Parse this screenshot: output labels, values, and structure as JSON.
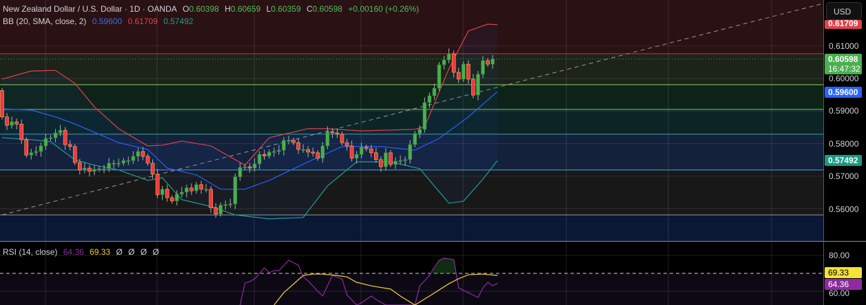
{
  "header": {
    "symbol": "New Zealand Dollar / U.S. Dollar · 1D · OANDA",
    "o_label": "O",
    "o": "0.60398",
    "h_label": "H",
    "h": "0.60659",
    "l_label": "L",
    "l": "0.60359",
    "c_label": "C",
    "c": "0.60598",
    "change": "+0.00160 (+0.26%)"
  },
  "bb_legend": {
    "label": "BB (20, SMA, close, 2)",
    "basis": "0.59600",
    "upper": "0.61709",
    "lower": "0.57492"
  },
  "rsi_legend": {
    "label": "RSI (14, close)",
    "rsi": "64.36",
    "ma": "69.33",
    "empties": [
      "Ø",
      "Ø",
      "Ø",
      "Ø"
    ]
  },
  "axis": {
    "currency": "USD",
    "price_ticks": [
      "0.61000",
      "0.60000",
      "0.59000",
      "0.58000",
      "0.57000",
      "0.56000"
    ],
    "rsi_ticks": [
      "80.00",
      "60.00"
    ],
    "tags": {
      "upper": "0.61709",
      "last": "0.60598",
      "countdown": "16:47:32",
      "basis": "0.59600",
      "lower": "0.57492",
      "rsi_ma": "69.33",
      "rsi": "64.36"
    }
  },
  "colors": {
    "up": "#4caf50",
    "down": "#f23645",
    "basis": "#2962ff",
    "upper": "#e0424a",
    "lower": "#22a08a",
    "rsi": "#8e2aa2",
    "rsi_ma": "#f2d13c"
  },
  "chart_data": {
    "type": "candlestick",
    "title": "New Zealand Dollar / U.S. Dollar · 1D · OANDA",
    "first_open": 0.5963,
    "closes": [
      0.5882,
      0.5856,
      0.5867,
      0.586,
      0.5812,
      0.5765,
      0.5772,
      0.5776,
      0.5793,
      0.5816,
      0.5818,
      0.5833,
      0.5841,
      0.5797,
      0.5791,
      0.5742,
      0.5719,
      0.5725,
      0.5715,
      0.5721,
      0.5723,
      0.5723,
      0.574,
      0.574,
      0.574,
      0.5748,
      0.5748,
      0.5761,
      0.5776,
      0.5761,
      0.574,
      0.5706,
      0.5643,
      0.566,
      0.5634,
      0.5624,
      0.5645,
      0.5651,
      0.5664,
      0.5655,
      0.5674,
      0.566,
      0.566,
      0.5603,
      0.5584,
      0.5611,
      0.5613,
      0.5615,
      0.5698,
      0.5727,
      0.5729,
      0.5725,
      0.5738,
      0.5767,
      0.5762,
      0.5774,
      0.5776,
      0.578,
      0.581,
      0.581,
      0.5803,
      0.5782,
      0.5782,
      0.5774,
      0.5772,
      0.5755,
      0.5793,
      0.5837,
      0.5833,
      0.5829,
      0.5803,
      0.5793,
      0.5755,
      0.5767,
      0.5789,
      0.5784,
      0.5772,
      0.5751,
      0.5729,
      0.5772,
      0.5736,
      0.5746,
      0.5748,
      0.5751,
      0.5797,
      0.5831,
      0.5844,
      0.5926,
      0.5947,
      0.597,
      0.6042,
      0.6057,
      0.6076,
      0.6019,
      0.5998,
      0.6044,
      0.5998,
      0.5949,
      0.6013,
      0.6055,
      0.6044,
      0.606
    ],
    "bb_upper": [
      [
        0,
        0.5998
      ],
      [
        6,
        0.6023
      ],
      [
        11,
        0.6025
      ],
      [
        15,
        0.5985
      ],
      [
        19,
        0.5913
      ],
      [
        24,
        0.5846
      ],
      [
        30,
        0.5793
      ],
      [
        33,
        0.5795
      ],
      [
        37,
        0.5808
      ],
      [
        43,
        0.5793
      ],
      [
        50,
        0.5734
      ],
      [
        55,
        0.5818
      ],
      [
        63,
        0.5846
      ],
      [
        67,
        0.5846
      ],
      [
        74,
        0.5839
      ],
      [
        85,
        0.5844
      ],
      [
        87,
        0.5852
      ],
      [
        92,
        0.603
      ],
      [
        96,
        0.6146
      ],
      [
        100,
        0.6167
      ],
      [
        102,
        0.6165
      ]
    ],
    "bb_basis": [
      [
        0,
        0.5907
      ],
      [
        6,
        0.5903
      ],
      [
        11,
        0.5882
      ],
      [
        15,
        0.586
      ],
      [
        19,
        0.5835
      ],
      [
        24,
        0.5803
      ],
      [
        30,
        0.5782
      ],
      [
        34,
        0.5725
      ],
      [
        40,
        0.5704
      ],
      [
        45,
        0.566
      ],
      [
        50,
        0.566
      ],
      [
        55,
        0.5687
      ],
      [
        63,
        0.5744
      ],
      [
        70,
        0.5791
      ],
      [
        78,
        0.5791
      ],
      [
        85,
        0.578
      ],
      [
        90,
        0.5816
      ],
      [
        96,
        0.5882
      ],
      [
        102,
        0.596
      ]
    ],
    "bb_lower": [
      [
        0,
        0.5818
      ],
      [
        6,
        0.5812
      ],
      [
        10,
        0.5806
      ],
      [
        15,
        0.575
      ],
      [
        19,
        0.5734
      ],
      [
        24,
        0.5719
      ],
      [
        30,
        0.5687
      ],
      [
        33,
        0.5695
      ],
      [
        37,
        0.5628
      ],
      [
        43,
        0.5607
      ],
      [
        48,
        0.5581
      ],
      [
        55,
        0.5569
      ],
      [
        62,
        0.5573
      ],
      [
        67,
        0.567
      ],
      [
        73,
        0.5744
      ],
      [
        80,
        0.5744
      ],
      [
        86,
        0.5723
      ],
      [
        92,
        0.5617
      ],
      [
        95,
        0.5623
      ],
      [
        99,
        0.5691
      ],
      [
        102,
        0.5748
      ]
    ],
    "levels": [
      0.6076,
      0.5981,
      0.5905,
      0.5829,
      0.5719,
      0.5581
    ],
    "rsi": [
      [
        49,
        52.3
      ],
      [
        50,
        64.6
      ],
      [
        51,
        65.4
      ],
      [
        52,
        66.9
      ],
      [
        54,
        73.1
      ],
      [
        55,
        70.4
      ],
      [
        56,
        71.5
      ],
      [
        57,
        71.5
      ],
      [
        59,
        77.3
      ],
      [
        61,
        74.6
      ],
      [
        62,
        68.1
      ],
      [
        63,
        65.8
      ],
      [
        65,
        60
      ],
      [
        66,
        57.3
      ],
      [
        68,
        68.8
      ],
      [
        70,
        66.9
      ],
      [
        71,
        58
      ],
      [
        73,
        52.3
      ],
      [
        74,
        53.5
      ],
      [
        76,
        57.3
      ],
      [
        77,
        55.4
      ],
      [
        79,
        52.3
      ],
      [
        85,
        52.3
      ],
      [
        86,
        63
      ],
      [
        88,
        68.8
      ],
      [
        89,
        73.5
      ],
      [
        90,
        77.3
      ],
      [
        91,
        78.5
      ],
      [
        93,
        77.7
      ],
      [
        94,
        61.9
      ],
      [
        96,
        59.2
      ],
      [
        98,
        56.5
      ],
      [
        99,
        61.9
      ],
      [
        100,
        65
      ],
      [
        101,
        63
      ],
      [
        102,
        64.4
      ]
    ],
    "rsi_ma": [
      [
        56,
        52.3
      ],
      [
        58,
        59.2
      ],
      [
        62,
        68.8
      ],
      [
        64,
        69.6
      ],
      [
        66,
        69.6
      ],
      [
        69,
        68.8
      ],
      [
        71,
        68
      ],
      [
        73,
        65
      ],
      [
        76,
        63
      ],
      [
        80,
        61.2
      ],
      [
        82,
        57.3
      ],
      [
        85,
        52.3
      ],
      [
        88,
        57.3
      ],
      [
        92,
        64.2
      ],
      [
        94,
        67
      ],
      [
        96,
        69.2
      ],
      [
        99,
        69.6
      ],
      [
        102,
        68.8
      ]
    ],
    "rsi_overbought": 70,
    "ylim": [
      0.552,
      0.622
    ]
  }
}
